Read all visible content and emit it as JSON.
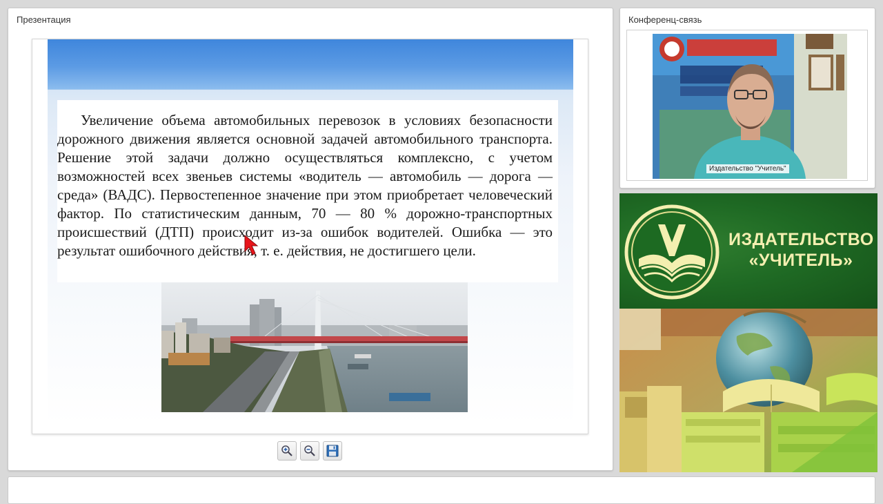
{
  "presentation": {
    "title": "Презентация",
    "slide": {
      "paragraph": "Увеличение объема автомобильных перевозок в условиях безопасности дорожного движения является основной задачей автомобильного транспорта. Решение этой задачи должно осуществляться комплексно, с учетом возможностей всех звеньев системы «водитель — автомобиль — дорога — среда» (ВАДС). Первостепенное значение при этом приобретает человеческий фактор. По статистическим данным, 70 — 80 % дорожно-транспортных происшествий (ДТП) происходит из-за ошибок водителей. Ошибка — это результат ошибочного действия, т. е. действия, не достигшего цели."
    },
    "toolbar": {
      "zoom_in_icon": "zoom-in-icon",
      "zoom_out_icon": "zoom-out-icon",
      "save_icon": "floppy-disk-icon"
    }
  },
  "conference": {
    "title": "Конференц-связь",
    "video_caption": "Издательство \"Учитель\""
  },
  "publisher": {
    "name_line1": "ИЗДАТЕЛЬСТВО",
    "name_line2": "«УЧИТЕЛЬ»",
    "logo": "uchitel-book-logo",
    "colors": {
      "green": "#1f6a24",
      "gold": "#f4efb0"
    }
  },
  "colors": {
    "slide_banner": "#4a8fe0",
    "cursor": "#e8151b"
  }
}
